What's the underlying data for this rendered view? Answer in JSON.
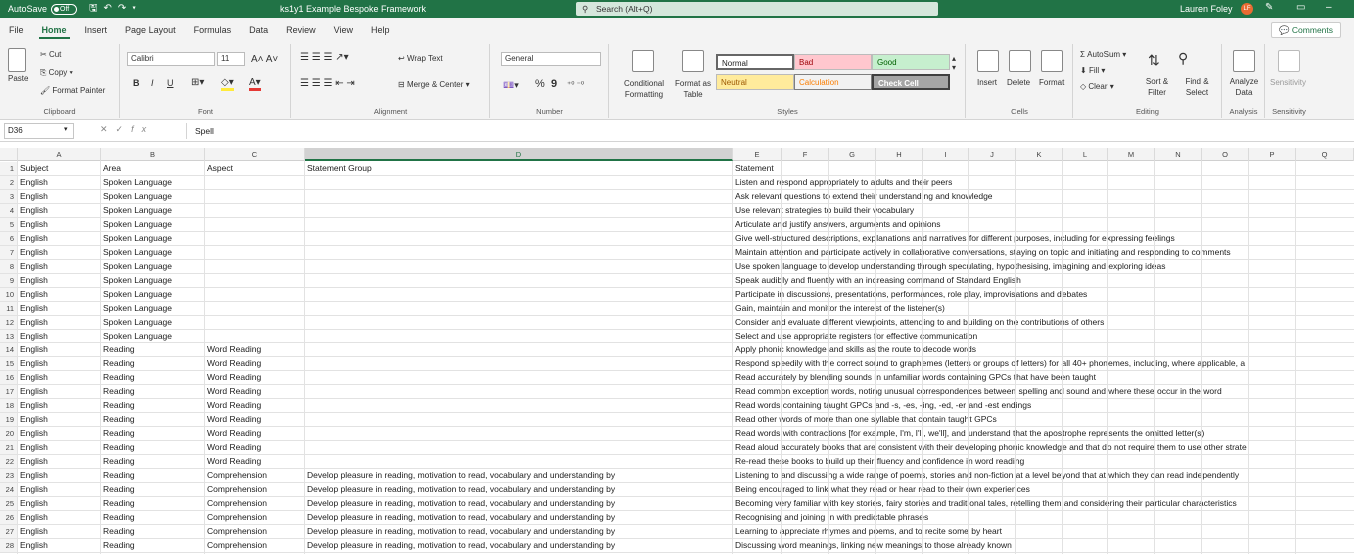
{
  "titlebar": {
    "autosave_label": "AutoSave",
    "autosave_state": "Off",
    "filename": "ks1y1 Example Bespoke Framework",
    "search_placeholder": "Search (Alt+Q)",
    "user_name": "Lauren Foley",
    "user_initials": "LF"
  },
  "menu": {
    "tabs": [
      "File",
      "Home",
      "Insert",
      "Page Layout",
      "Formulas",
      "Data",
      "Review",
      "View",
      "Help"
    ],
    "active": "Home",
    "comments_label": "Comments"
  },
  "ribbon": {
    "clipboard": {
      "paste": "Paste",
      "cut": "Cut",
      "copy": "Copy",
      "format_painter": "Format Painter",
      "label": "Clipboard"
    },
    "font": {
      "name": "Calibri",
      "size": "11",
      "label": "Font",
      "bold": "B",
      "italic": "I",
      "underline": "U"
    },
    "alignment": {
      "wrap": "Wrap Text",
      "merge": "Merge & Center",
      "label": "Alignment"
    },
    "number": {
      "format": "General",
      "percent": "%",
      "comma": "9",
      "label": "Number"
    },
    "styles": {
      "conditional": "Conditional Formatting",
      "format_as_table": "Format as Table",
      "normal": "Normal",
      "bad": "Bad",
      "good": "Good",
      "neutral": "Neutral",
      "calculation": "Calculation",
      "check_cell": "Check Cell",
      "label": "Styles"
    },
    "cells": {
      "insert": "Insert",
      "delete": "Delete",
      "format": "Format",
      "label": "Cells"
    },
    "editing": {
      "autosum": "AutoSum",
      "fill": "Fill",
      "clear": "Clear",
      "sort_filter": "Sort & Filter",
      "find_select": "Find & Select",
      "label": "Editing"
    },
    "analysis": {
      "analyze": "Analyze Data",
      "label": "Analysis"
    },
    "sensitivity": {
      "button": "Sensitivity",
      "label": "Sensitivity"
    }
  },
  "formula_bar": {
    "cell_ref": "D36",
    "fx": "fx",
    "content": "Spell"
  },
  "columns": [
    "A",
    "B",
    "C",
    "D",
    "E",
    "F",
    "G",
    "H",
    "I",
    "J",
    "K",
    "L",
    "M",
    "N",
    "O",
    "P",
    "Q"
  ],
  "selected_column": "D",
  "rows": [
    {
      "n": "1",
      "a": "Subject",
      "b": "Area",
      "c": "Aspect",
      "d": "Statement Group",
      "e": "Statement"
    },
    {
      "n": "2",
      "a": "English",
      "b": "Spoken Language",
      "c": "",
      "d": "",
      "e": "Listen and respond appropriately to adults and their peers"
    },
    {
      "n": "3",
      "a": "English",
      "b": "Spoken Language",
      "c": "",
      "d": "",
      "e": "Ask relevant questions to extend their understanding and knowledge"
    },
    {
      "n": "4",
      "a": "English",
      "b": "Spoken Language",
      "c": "",
      "d": "",
      "e": "Use relevant strategies to build their vocabulary"
    },
    {
      "n": "5",
      "a": "English",
      "b": "Spoken Language",
      "c": "",
      "d": "",
      "e": "Articulate and justify answers, arguments and opinions"
    },
    {
      "n": "6",
      "a": "English",
      "b": "Spoken Language",
      "c": "",
      "d": "",
      "e": "Give well-structured descriptions, explanations and narratives for different purposes, including for expressing feelings"
    },
    {
      "n": "7",
      "a": "English",
      "b": "Spoken Language",
      "c": "",
      "d": "",
      "e": "Maintain attention and participate actively in collaborative conversations, staying on topic and initiating and responding to comments"
    },
    {
      "n": "8",
      "a": "English",
      "b": "Spoken Language",
      "c": "",
      "d": "",
      "e": "Use spoken language to develop understanding through speculating, hypothesising, imagining and exploring ideas"
    },
    {
      "n": "9",
      "a": "English",
      "b": "Spoken Language",
      "c": "",
      "d": "",
      "e": "Speak audibly and fluently with an increasing command of Standard English"
    },
    {
      "n": "10",
      "a": "English",
      "b": "Spoken Language",
      "c": "",
      "d": "",
      "e": "Participate in discussions, presentations, performances, role play, improvisations and debates"
    },
    {
      "n": "11",
      "a": "English",
      "b": "Spoken Language",
      "c": "",
      "d": "",
      "e": "Gain, maintain and monitor the interest of the listener(s)"
    },
    {
      "n": "12",
      "a": "English",
      "b": "Spoken Language",
      "c": "",
      "d": "",
      "e": "Consider and evaluate different viewpoints, attending to and building on the contributions of others"
    },
    {
      "n": "13",
      "a": "English",
      "b": "Spoken Language",
      "c": "",
      "d": "",
      "e": "Select and use appropriate registers for effective communication"
    },
    {
      "n": "14",
      "a": "English",
      "b": "Reading",
      "c": "Word Reading",
      "d": "",
      "e": "Apply phonic knowledge and skills as the route to decode words"
    },
    {
      "n": "15",
      "a": "English",
      "b": "Reading",
      "c": "Word Reading",
      "d": "",
      "e": "Respond speedily with the correct sound to graphemes (letters or groups of letters) for all 40+ phonemes, including, where applicable, a"
    },
    {
      "n": "16",
      "a": "English",
      "b": "Reading",
      "c": "Word Reading",
      "d": "",
      "e": "Read accurately by blending sounds in unfamiliar words containing GPCs that have been taught"
    },
    {
      "n": "17",
      "a": "English",
      "b": "Reading",
      "c": "Word Reading",
      "d": "",
      "e": "Read common exception words, noting unusual correspondences between spelling and sound and where these occur in the word"
    },
    {
      "n": "18",
      "a": "English",
      "b": "Reading",
      "c": "Word Reading",
      "d": "",
      "e": "Read words containing taught GPCs and -s, -es, -ing, -ed, -er and -est endings"
    },
    {
      "n": "19",
      "a": "English",
      "b": "Reading",
      "c": "Word Reading",
      "d": "",
      "e": "Read other words of more than one syllable that contain taught GPCs"
    },
    {
      "n": "20",
      "a": "English",
      "b": "Reading",
      "c": "Word Reading",
      "d": "",
      "e": "Read words with contractions [for example, I'm, I'll, we'll], and understand that the apostrophe represents the omitted letter(s)"
    },
    {
      "n": "21",
      "a": "English",
      "b": "Reading",
      "c": "Word Reading",
      "d": "",
      "e": "Read aloud accurately books that are consistent with their developing phonic knowledge and that do not require them to use other strate"
    },
    {
      "n": "22",
      "a": "English",
      "b": "Reading",
      "c": "Word Reading",
      "d": "",
      "e": "Re-read these books to build up their fluency and confidence in word reading"
    },
    {
      "n": "23",
      "a": "English",
      "b": "Reading",
      "c": "Comprehension",
      "d": "Develop pleasure in reading, motivation to read, vocabulary and understanding by",
      "e": "Listening to and discussing a wide range of poems, stories and non-fiction at a level beyond that at which they can read independently"
    },
    {
      "n": "24",
      "a": "English",
      "b": "Reading",
      "c": "Comprehension",
      "d": "Develop pleasure in reading, motivation to read, vocabulary and understanding by",
      "e": "Being encouraged to link what they read or hear read to their own experiences"
    },
    {
      "n": "25",
      "a": "English",
      "b": "Reading",
      "c": "Comprehension",
      "d": "Develop pleasure in reading, motivation to read, vocabulary and understanding by",
      "e": "Becoming very familiar with key stories, fairy stories and traditional tales, retelling them and considering their particular characteristics"
    },
    {
      "n": "26",
      "a": "English",
      "b": "Reading",
      "c": "Comprehension",
      "d": "Develop pleasure in reading, motivation to read, vocabulary and understanding by",
      "e": "Recognising and joining in with predictable phrases"
    },
    {
      "n": "27",
      "a": "English",
      "b": "Reading",
      "c": "Comprehension",
      "d": "Develop pleasure in reading, motivation to read, vocabulary and understanding by",
      "e": "Learning to appreciate rhymes and poems, and to recite some by heart"
    },
    {
      "n": "28",
      "a": "English",
      "b": "Reading",
      "c": "Comprehension",
      "d": "Develop pleasure in reading, motivation to read, vocabulary and understanding by",
      "e": "Discussing word meanings, linking new meanings to those already known"
    }
  ]
}
